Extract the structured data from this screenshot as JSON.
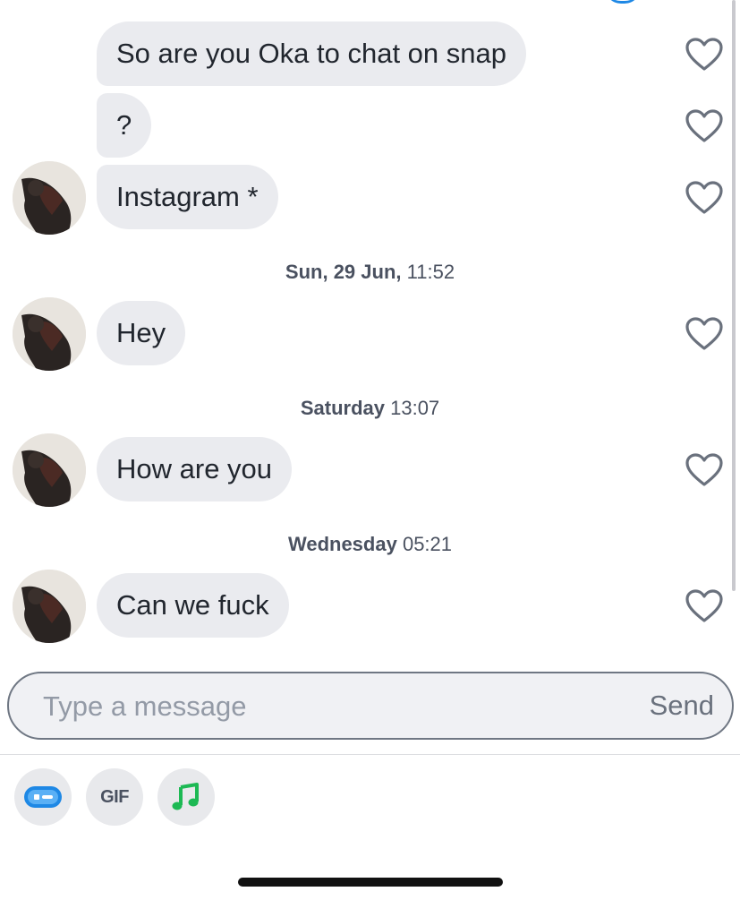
{
  "messages": [
    {
      "text": "So are you Oka to chat on snap",
      "avatar": false,
      "style": "first"
    },
    {
      "text": "?",
      "avatar": false,
      "style": "middle"
    },
    {
      "text": "Instagram *",
      "avatar": true,
      "style": "last"
    },
    {
      "text": "Hey",
      "avatar": true,
      "style": "single"
    },
    {
      "text": "How are you",
      "avatar": true,
      "style": "single"
    },
    {
      "text": "Can we fuck",
      "avatar": true,
      "style": "single"
    }
  ],
  "timestamps": [
    {
      "day": "Sun, 29 Jun,",
      "time": "11:52"
    },
    {
      "day": "Saturday",
      "time": "13:07"
    },
    {
      "day": "Wednesday",
      "time": "05:21"
    }
  ],
  "composer": {
    "placeholder": "Type a message",
    "send_label": "Send"
  },
  "toolbar": {
    "sticker_icon": "chat-sticker-icon",
    "gif_label": "GIF",
    "music_icon": "music-note-icon"
  },
  "colors": {
    "bubble": "#eaebef",
    "accent_blue": "#1e88e5",
    "music_green": "#1db954"
  }
}
